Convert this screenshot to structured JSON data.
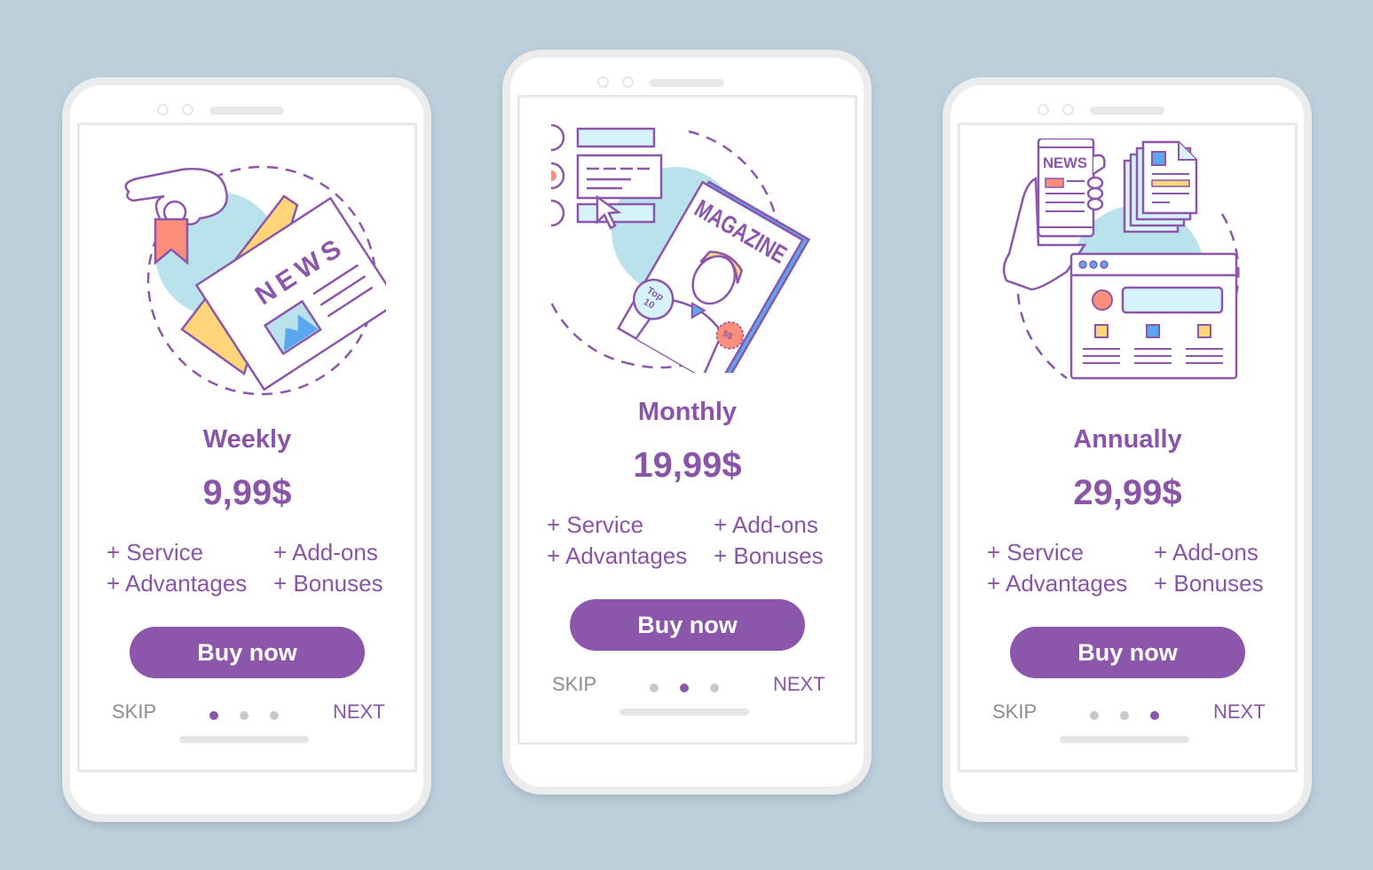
{
  "colors": {
    "background": "#bccfdb",
    "accent": "#8c56ab",
    "muted_text": "#8c8c8c",
    "dot_inactive": "#c8c8c8",
    "light_blue": "#b9e2ec",
    "coral": "#fa8e7a",
    "yellow": "#ffd57a",
    "blue": "#5aa6f0"
  },
  "screens": [
    {
      "illustration": "newspaper-hand-icon",
      "illustration_text": "NEWS",
      "title": "Weekly",
      "price": "9,99$",
      "features": [
        "+ Service",
        "+ Add-ons",
        "+ Advantages",
        "+ Bonuses"
      ],
      "buy_label": "Buy now",
      "skip_label": "SKIP",
      "next_label": "NEXT",
      "page_index": 1,
      "page_count": 3
    },
    {
      "illustration": "magazine-icon",
      "illustration_text": "MAGAZINE",
      "badge_text": "Top 10",
      "sticker_text": "5$",
      "title": "Monthly",
      "price": "19,99$",
      "features": [
        "+ Service",
        "+ Add-ons",
        "+ Advantages",
        "+ Bonuses"
      ],
      "buy_label": "Buy now",
      "skip_label": "SKIP",
      "next_label": "NEXT",
      "page_index": 2,
      "page_count": 3
    },
    {
      "illustration": "news-app-icon",
      "illustration_text": "NEWS",
      "title": "Annually",
      "price": "29,99$",
      "features": [
        "+ Service",
        "+ Add-ons",
        "+ Advantages",
        "+ Bonuses"
      ],
      "buy_label": "Buy now",
      "skip_label": "SKIP",
      "next_label": "NEXT",
      "page_index": 3,
      "page_count": 3
    }
  ]
}
